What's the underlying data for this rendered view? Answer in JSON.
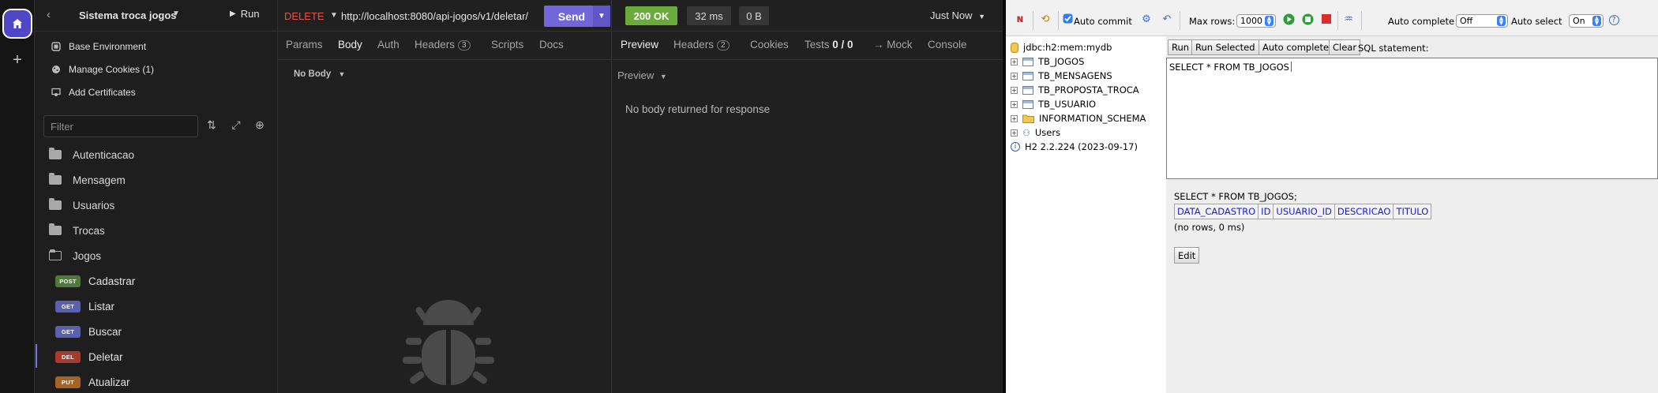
{
  "insomnia": {
    "project": {
      "name": "Sistema troca jogos",
      "run_label": "Run"
    },
    "environment_items": [
      {
        "label": "Base Environment"
      },
      {
        "label": "Manage Cookies (1)"
      },
      {
        "label": "Add Certificates"
      }
    ],
    "filter_placeholder": "Filter",
    "folders": [
      {
        "label": "Autenticacao"
      },
      {
        "label": "Mensagem"
      },
      {
        "label": "Usuarios"
      },
      {
        "label": "Trocas"
      },
      {
        "label": "Jogos"
      }
    ],
    "requests": [
      {
        "method": "POST",
        "label": "Cadastrar",
        "color": "#4d7a35"
      },
      {
        "method": "GET",
        "label": "Listar",
        "color": "#5a5fb0"
      },
      {
        "method": "GET",
        "label": "Buscar",
        "color": "#5a5fb0"
      },
      {
        "method": "DEL",
        "label": "Deletar",
        "color": "#a83a2e"
      },
      {
        "method": "PUT",
        "label": "Atualizar",
        "color": "#a66324"
      }
    ],
    "request": {
      "method": "DELETE",
      "url": "http://localhost:8080/api-jogos/v1/deletar/",
      "send_label": "Send",
      "tabs": [
        "Params",
        "Body",
        "Auth",
        "Headers",
        "Scripts",
        "Docs"
      ],
      "headers_count": "3",
      "body_type": "No Body"
    },
    "response": {
      "status": "200 OK",
      "time": "32 ms",
      "size": "0 B",
      "when": "Just Now",
      "tabs": [
        "Preview",
        "Headers",
        "Cookies",
        "Tests",
        "→ Mock",
        "Console"
      ],
      "headers_count": "2",
      "tests_count": "0 / 0",
      "preview_label": "Preview",
      "empty_message": "No body returned for response"
    },
    "accent_color": "#7366d9",
    "status_color": "#6bab3c"
  },
  "h2": {
    "toolbar": {
      "auto_commit_label": "Auto commit",
      "max_rows_label": "Max rows:",
      "max_rows_value": "1000",
      "auto_complete_label": "Auto complete",
      "auto_complete_value": "Off",
      "auto_select_label": "Auto select",
      "auto_select_value": "On",
      "help": "?"
    },
    "tree": {
      "connection": "jdbc:h2:mem:mydb",
      "tables": [
        "TB_JOGOS",
        "TB_MENSAGENS",
        "TB_PROPOSTA_TROCA",
        "TB_USUARIO"
      ],
      "schema": "INFORMATION_SCHEMA",
      "users": "Users",
      "version": "H2 2.2.224 (2023-09-17)"
    },
    "buttons": {
      "run": "Run",
      "run_selected": "Run Selected",
      "auto_complete": "Auto complete",
      "clear": "Clear",
      "sql_statement": "SQL statement:"
    },
    "sql_text": "SELECT * FROM TB_JOGOS",
    "result": {
      "query": "SELECT * FROM TB_JOGOS;",
      "columns": [
        "DATA_CADASTRO",
        "ID",
        "USUARIO_ID",
        "DESCRICAO",
        "TITULO"
      ],
      "status": "(no rows, 0 ms)",
      "edit_label": "Edit"
    }
  }
}
